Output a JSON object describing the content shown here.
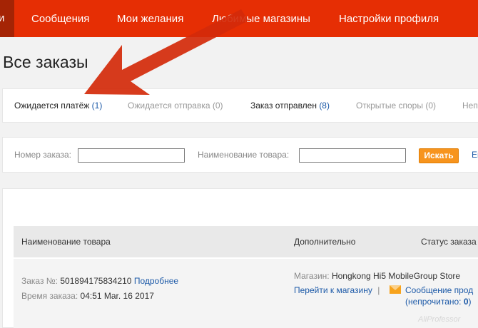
{
  "topnav": {
    "stub_label": "и",
    "items": [
      {
        "label": "Сообщения"
      },
      {
        "label": "Мои желания"
      },
      {
        "label": "Любимые магазины"
      },
      {
        "label": "Настройки профиля"
      }
    ],
    "accent": "#e62e04"
  },
  "page_title": "Все заказы",
  "tabs": [
    {
      "label": "Ожидается платёж",
      "count": "(1)"
    },
    {
      "label": "Ожидается отправка",
      "count": "(0)"
    },
    {
      "label": "Заказ отправлен",
      "count": "(8)"
    },
    {
      "label": "Открытые споры",
      "count": "(0)"
    },
    {
      "label": "Неп"
    }
  ],
  "filters": {
    "order_number_label": "Номер заказа:",
    "order_number_value": "",
    "product_name_label": "Наименование товара:",
    "product_name_value": "",
    "search_button": "Искать",
    "extra_link": "Ещ",
    "button_color": "#f7941d"
  },
  "orders": {
    "columns": [
      "Наименование товара",
      "Дополнительно",
      "Статус заказа"
    ],
    "row": {
      "order_no_label": "Заказ №:",
      "order_no": "501894175834210",
      "details_link": "Подробнее",
      "time_label": "Время заказа:",
      "time_value": "04:51 Mar. 16 2017",
      "store_label": "Магазин:",
      "store_name": "Hongkong Hi5 MobileGroup Store",
      "go_store_link": "Перейти к магазину",
      "separator": "|",
      "message_link": "Сообщение прод",
      "unread_label": "(непрочитано: ",
      "unread_count": "0",
      "unread_close": ")"
    }
  },
  "watermark": "AliProfessor",
  "arrow_color": "#d42a0a"
}
